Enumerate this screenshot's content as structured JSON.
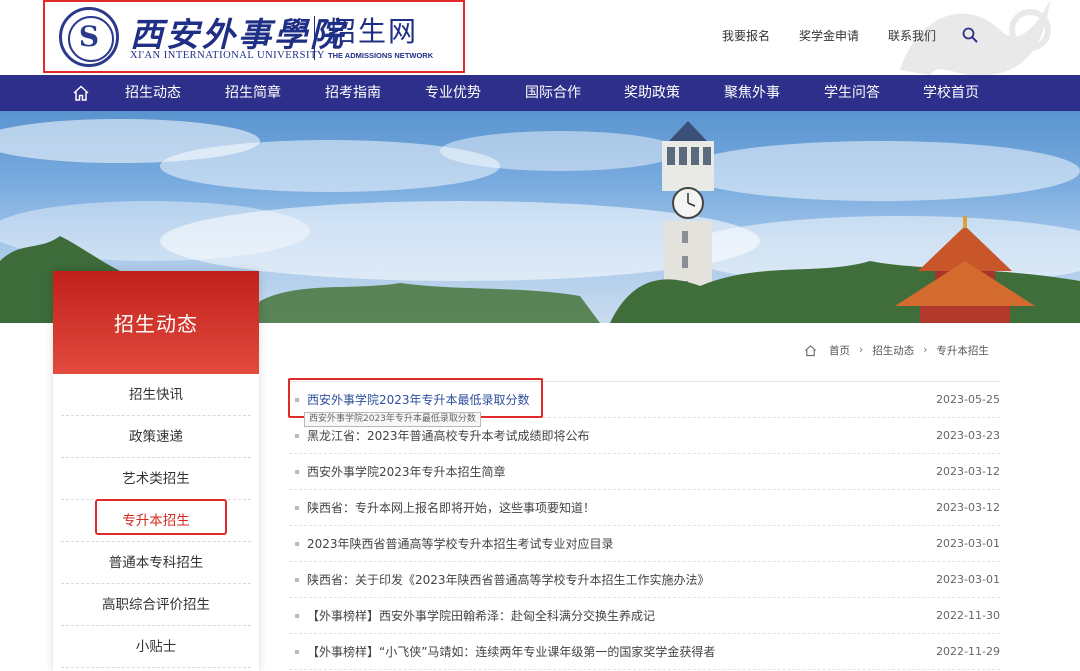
{
  "header": {
    "school_name_cn": "西安外事學院",
    "school_name_en": "XI'AN INTERNATIONAL UNIVERSITY",
    "site_name_cn": "招生网",
    "site_name_en": "THE ADMISSIONS NETWORK",
    "top_links": [
      "我要报名",
      "奖学金申请",
      "联系我们"
    ]
  },
  "nav": {
    "items": [
      "招生动态",
      "招生简章",
      "招考指南",
      "专业优势",
      "国际合作",
      "奖助政策",
      "聚焦外事",
      "学生问答",
      "学校首页"
    ]
  },
  "sidebar": {
    "title": "招生动态",
    "items": [
      "招生快讯",
      "政策速递",
      "艺术类招生",
      "专升本招生",
      "普通本专科招生",
      "高职综合评价招生",
      "小贴士"
    ],
    "active_index": 3
  },
  "breadcrumb": [
    "首页",
    "招生动态",
    "专升本招生"
  ],
  "articles": [
    {
      "title": "西安外事学院2023年专升本最低录取分数",
      "date": "2023-05-25"
    },
    {
      "title": "黑龙江省：2023年普通高校专升本考试成绩即将公布",
      "date": "2023-03-23"
    },
    {
      "title": "西安外事学院2023年专升本招生简章",
      "date": "2023-03-12"
    },
    {
      "title": "陕西省：专升本网上报名即将开始，这些事项要知道！",
      "date": "2023-03-12"
    },
    {
      "title": "2023年陕西省普通高等学校专升本招生考试专业对应目录",
      "date": "2023-03-01"
    },
    {
      "title": "陕西省：关于印发《2023年陕西省普通高等学校专升本招生工作实施办法》",
      "date": "2023-03-01"
    },
    {
      "title": "【外事榜样】西安外事学院田翰希泽：赴匈全科满分交换生养成记",
      "date": "2022-11-30"
    },
    {
      "title": "【外事榜样】“小飞侠”马靖如：连续两年专业课年级第一的国家奖学金获得者",
      "date": "2022-11-29"
    }
  ],
  "tooltip": "西安外事学院2023年专升本最低录取分数",
  "colors": {
    "nav_bg": "#2d2f8a",
    "brand_blue": "#1f2f86",
    "sidebar_red": "#d42a1e",
    "highlight_box": "#e02a2a"
  }
}
